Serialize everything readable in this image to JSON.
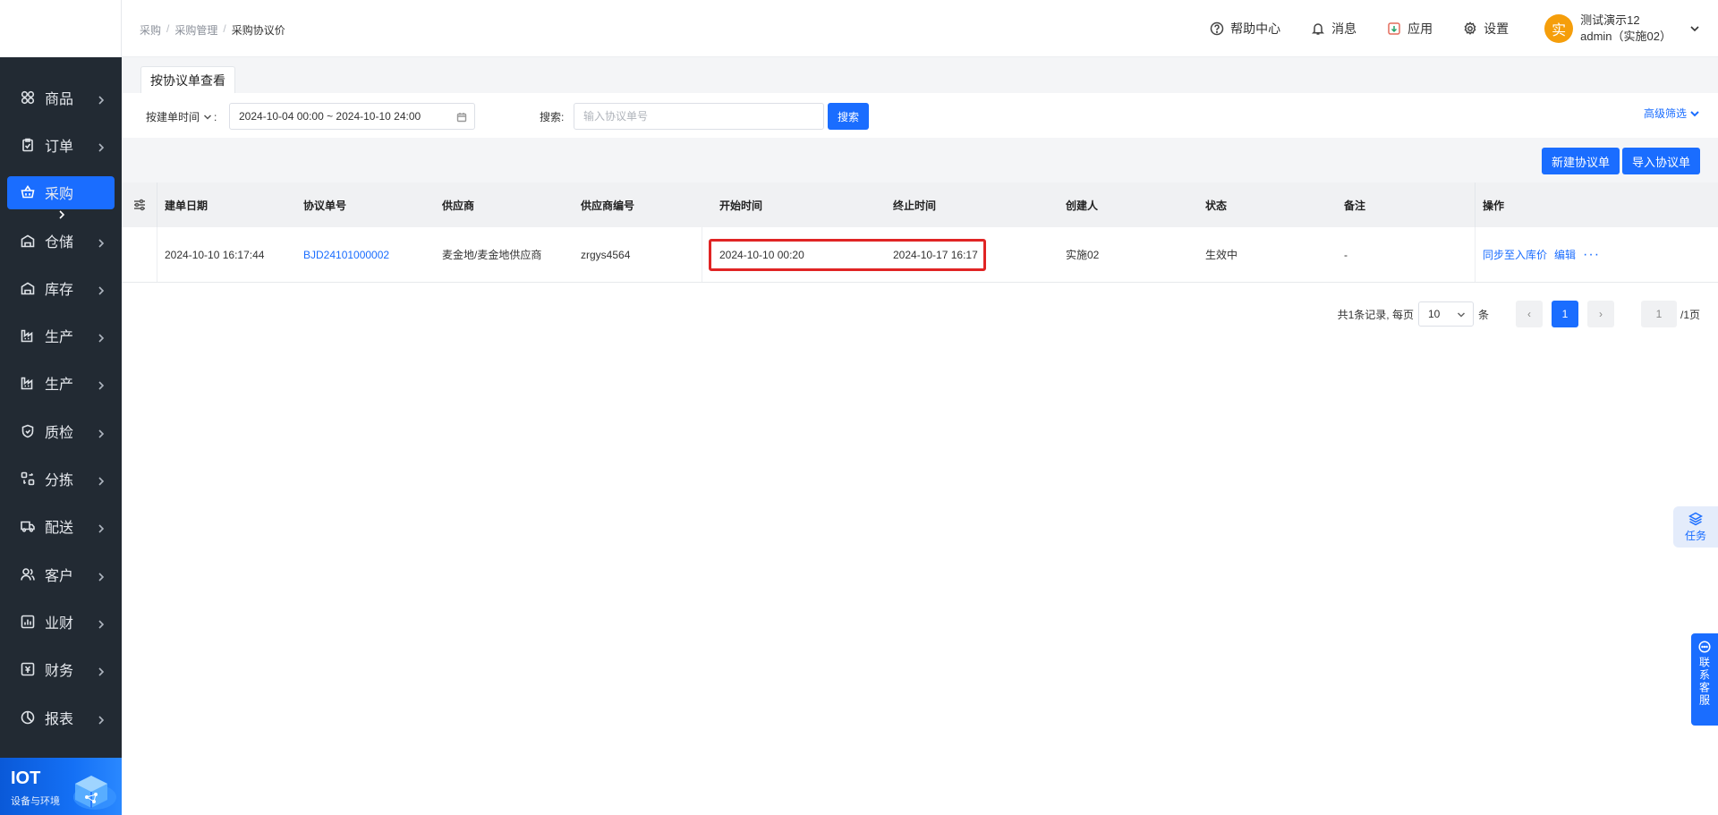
{
  "sidebar": {
    "items": [
      {
        "label": "商品",
        "icon": "grid-icon"
      },
      {
        "label": "订单",
        "icon": "clipboard-icon"
      },
      {
        "label": "采购",
        "icon": "basket-icon",
        "active": true
      },
      {
        "label": "仓储",
        "icon": "warehouse-icon"
      },
      {
        "label": "库存",
        "icon": "warehouse-icon"
      },
      {
        "label": "生产",
        "icon": "factory-icon"
      },
      {
        "label": "生产",
        "icon": "factory-icon"
      },
      {
        "label": "质检",
        "icon": "shield-icon"
      },
      {
        "label": "分拣",
        "icon": "sort-icon"
      },
      {
        "label": "配送",
        "icon": "truck-icon"
      },
      {
        "label": "客户",
        "icon": "users-icon"
      },
      {
        "label": "业财",
        "icon": "bar-chart-icon"
      },
      {
        "label": "财务",
        "icon": "finance-icon"
      },
      {
        "label": "报表",
        "icon": "pie-chart-icon"
      }
    ],
    "iot": {
      "title": "IOT",
      "subtitle": "设备与环境"
    }
  },
  "header": {
    "breadcrumb": [
      "采购",
      "采购管理",
      "采购协议价"
    ],
    "help": "帮助中心",
    "messages": "消息",
    "apps": "应用",
    "settings": "设置",
    "user": {
      "avatar_char": "实",
      "name": "测试演示12",
      "account": "admin（实施02）"
    }
  },
  "tabs": [
    {
      "label": "按协议单查看"
    }
  ],
  "filter": {
    "date_type_label": "按建单时间",
    "date_range": "2024-10-04 00:00 ~ 2024-10-10 24:00",
    "search_label": "搜索:",
    "search_placeholder": "输入协议单号",
    "search_button": "搜索",
    "advanced": "高级筛选"
  },
  "toolbar": {
    "new_button": "新建协议单",
    "import_button": "导入协议单"
  },
  "table": {
    "headers": [
      "建单日期",
      "协议单号",
      "供应商",
      "供应商编号",
      "开始时间",
      "终止时间",
      "创建人",
      "状态",
      "备注",
      "操作"
    ],
    "rows": [
      {
        "created": "2024-10-10 16:17:44",
        "order_no": "BJD24101000002",
        "supplier": "麦金地/麦金地供应商",
        "supplier_code": "zrgys4564",
        "start": "2024-10-10 00:20",
        "end": "2024-10-17 16:17",
        "creator": "实施02",
        "status": "生效中",
        "remark": "-",
        "op_sync": "同步至入库价",
        "op_edit": "编辑",
        "op_more": "···"
      }
    ]
  },
  "pagination": {
    "summary": "共1条记录, 每页",
    "page_size": "10",
    "unit": "条",
    "prev": "‹",
    "current": "1",
    "next": "›",
    "jump": "1",
    "total_pages": "/1页"
  },
  "float": {
    "task": "任务",
    "contact": "联系客服"
  },
  "colors": {
    "primary": "#1a6dff",
    "sidebar": "#222a33",
    "highlight": "#e02424",
    "avatar": "#f59e0b"
  }
}
